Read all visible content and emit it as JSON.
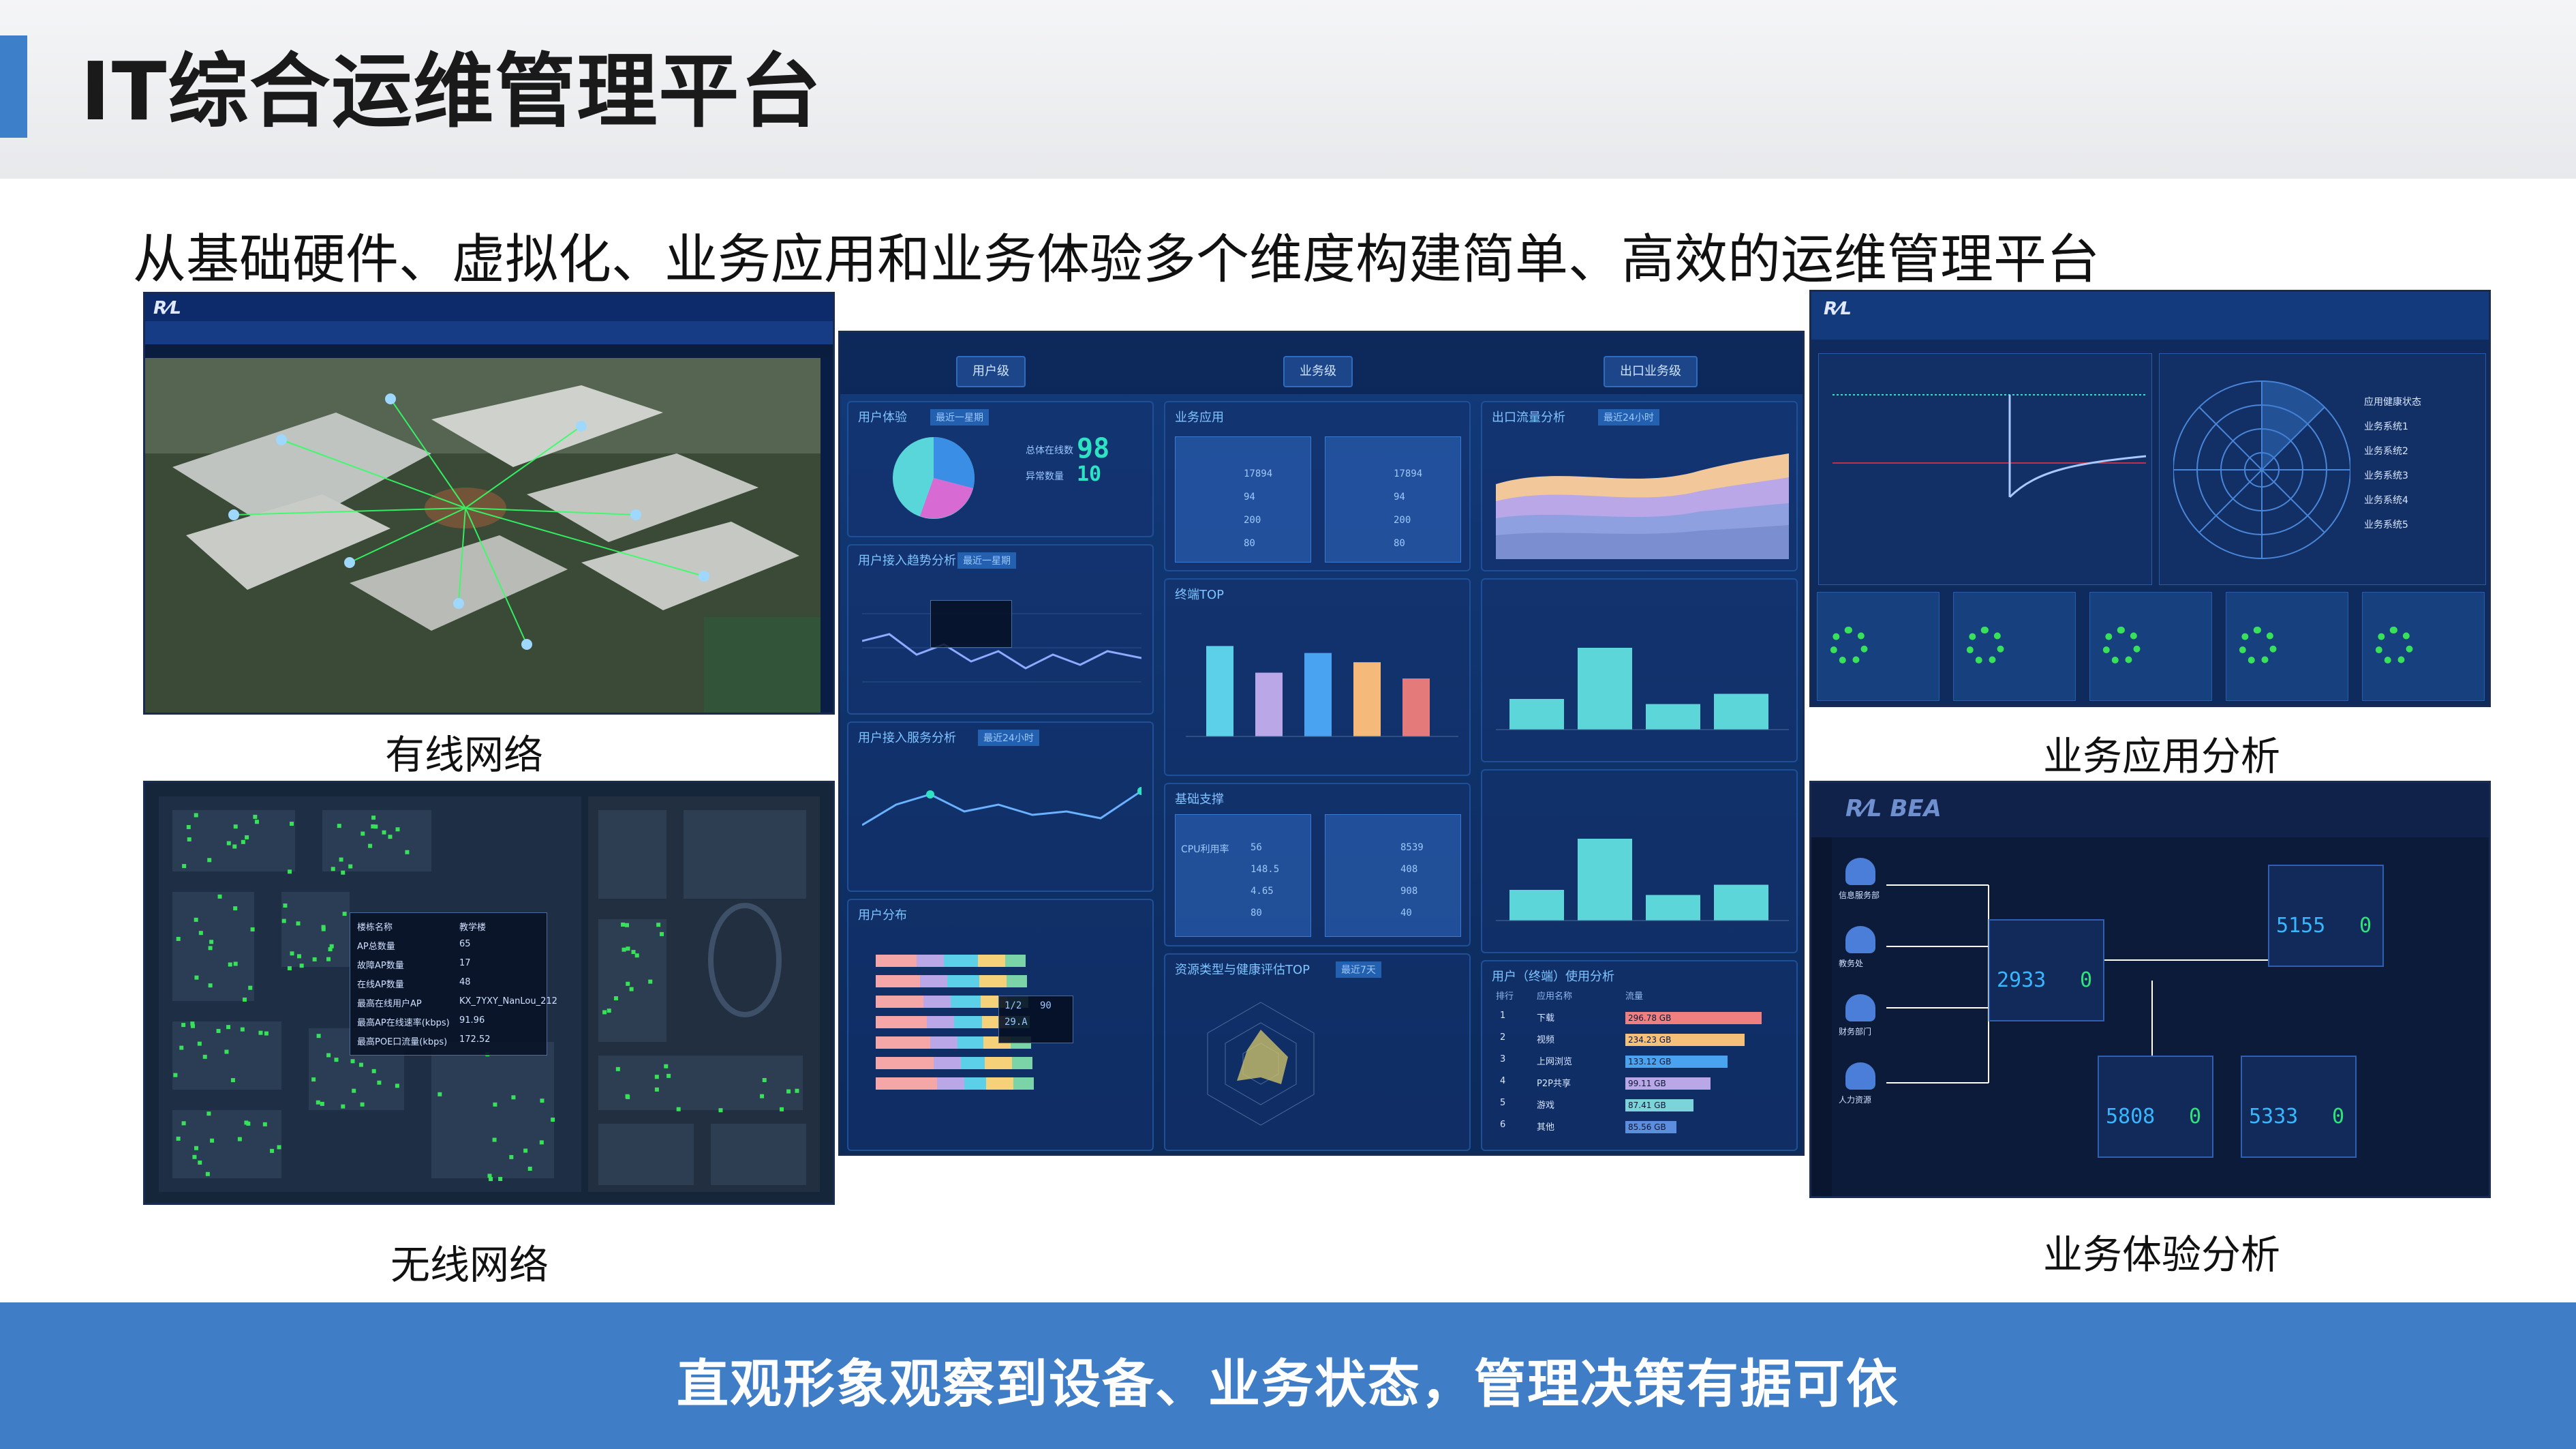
{
  "slide": {
    "title": "IT综合运维管理平台",
    "subtitle": "从基础硬件、虚拟化、业务应用和业务体验多个维度构建简单、高效的运维管理平台",
    "footer": "直观形象观察到设备、业务状态，管理决策有据可依"
  },
  "captions": {
    "wired": "有线网络",
    "wireless": "无线网络",
    "app_analysis": "业务应用分析",
    "experience_analysis": "业务体验分析"
  },
  "dashboard": {
    "tabs": [
      "用户级",
      "业务级",
      "出口业务级"
    ],
    "panels": {
      "user_status": "用户体验",
      "user_status_dropdown": "最近一星期",
      "total_users_label": "总体在线数",
      "total_users": "98",
      "abnormal_label": "异常数量",
      "abnormal": "10",
      "business_app": "业务应用",
      "app_value_a": "17894",
      "app_value_b": "17894",
      "app_stat_a": "94",
      "app_stat_b": "94",
      "app_time_a": "200",
      "app_time_b": "200",
      "app_pct_a": "80",
      "app_pct_b": "80",
      "export_traffic": "出口流量分析",
      "export_dropdown": "最近24小时",
      "bar_panel": "终端TOP",
      "basic_support": "基础支撑",
      "cpu_label": "CPU利用率",
      "cpu_value": "56",
      "mem_value": "148.5",
      "disk_value": "4.65",
      "pct_value": "80",
      "rate_a": "8539",
      "rate_b": "408",
      "rate_c": "908",
      "rate_d": "40",
      "resource_radar": "资源类型与健康评估TOP",
      "radar_dropdown": "最近7天",
      "user_table_title": "用户（终端）使用分析",
      "table_headers": [
        "排行",
        "应用名称",
        "流量"
      ],
      "table_rows": [
        {
          "rank": "1",
          "name": "下载",
          "value": "296.78 GB"
        },
        {
          "rank": "2",
          "name": "视频",
          "value": "234.23 GB"
        },
        {
          "rank": "3",
          "name": "上网浏览",
          "value": "133.12 GB"
        },
        {
          "rank": "4",
          "name": "P2P共享",
          "value": "99.11 GB"
        },
        {
          "rank": "5",
          "name": "游戏",
          "value": "87.41 GB"
        },
        {
          "rank": "6",
          "name": "其他",
          "value": "85.56 GB"
        }
      ],
      "access_title": "用户接入趋势分析",
      "access_dropdown": "最近一星期",
      "latency_title": "用户接入服务分析",
      "latency_dropdown": "最近24小时",
      "user_stack": "用户分布",
      "tooltip_a": "1/2",
      "tooltip_b": "90",
      "tooltip_c": "29.A"
    },
    "bar_values": [
      78,
      55,
      72,
      64,
      50
    ],
    "hist_values": [
      30,
      80,
      25,
      35
    ],
    "hist_values_2": [
      30,
      80,
      25,
      35
    ]
  },
  "wireless_popup": {
    "rows": [
      [
        "楼栋名称",
        "教学楼"
      ],
      [
        "AP总数量",
        "65"
      ],
      [
        "故障AP数量",
        "17"
      ],
      [
        "在线AP数量",
        "48"
      ],
      [
        "最高在线用户AP",
        "KX_7YXY_NanLou_212"
      ],
      [
        "最高AP在线速率(kbps)",
        "91.96"
      ],
      [
        "最高POE口流量(kbps)",
        "172.52"
      ]
    ]
  },
  "experience": {
    "nodes": [
      {
        "value": "5155",
        "tail": "0"
      },
      {
        "value": "2933",
        "tail": "0"
      },
      {
        "value": "5808",
        "tail": "0"
      },
      {
        "value": "5333",
        "tail": "0"
      }
    ],
    "side_labels": [
      "信息服务部",
      "教务处",
      "财务部门",
      "人力资源"
    ]
  },
  "app_analysis": {
    "side_labels": [
      "应用健康状态",
      "业务系统1",
      "业务系统2",
      "业务系统3",
      "业务系统4",
      "业务系统5"
    ]
  },
  "colors": {
    "accent": "#3f7dc6",
    "teal": "#2de3c3",
    "dash_bg": "#0c2a5a"
  }
}
